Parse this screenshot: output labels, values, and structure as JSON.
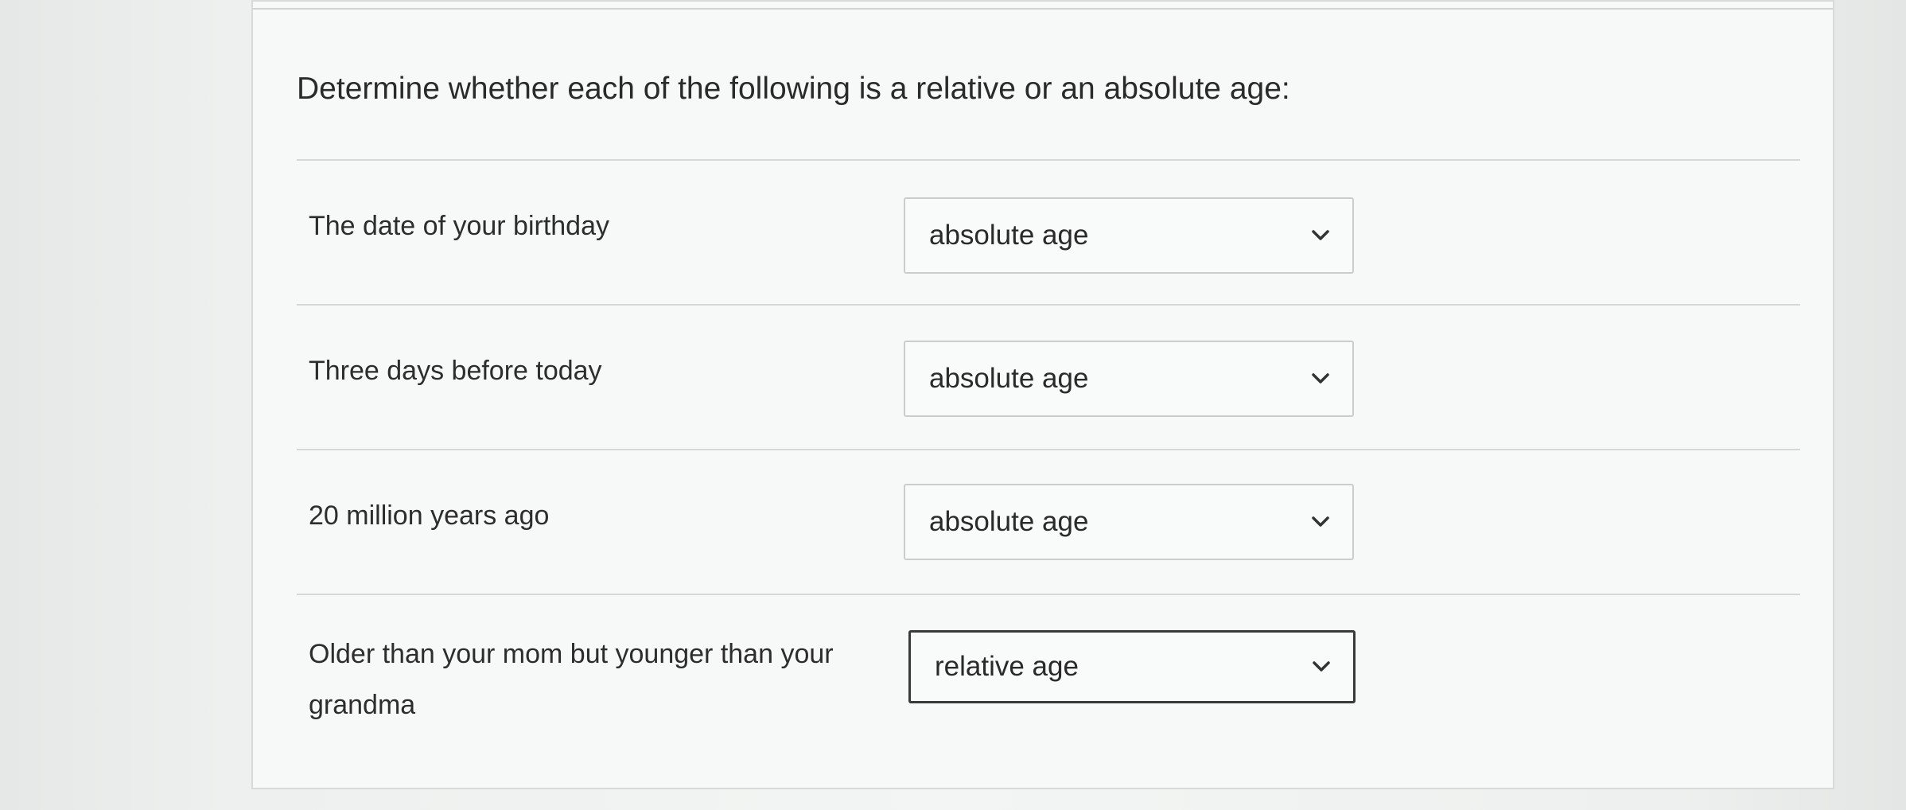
{
  "question": {
    "prompt": "Determine whether each of the following is a relative or an absolute age:"
  },
  "rows": [
    {
      "label": "The date of your birthday",
      "selected": "absolute age"
    },
    {
      "label": "Three days before today",
      "selected": "absolute age"
    },
    {
      "label": "20 million years ago",
      "selected": "absolute age"
    },
    {
      "label": "Older than your mom but younger than your grandma",
      "selected": "relative age"
    }
  ],
  "icons": {
    "dropdown": "chevron-down-icon"
  },
  "colors": {
    "focus_border": "#3a3a3a",
    "border": "#c9cdce",
    "text": "#2a2a2a"
  }
}
